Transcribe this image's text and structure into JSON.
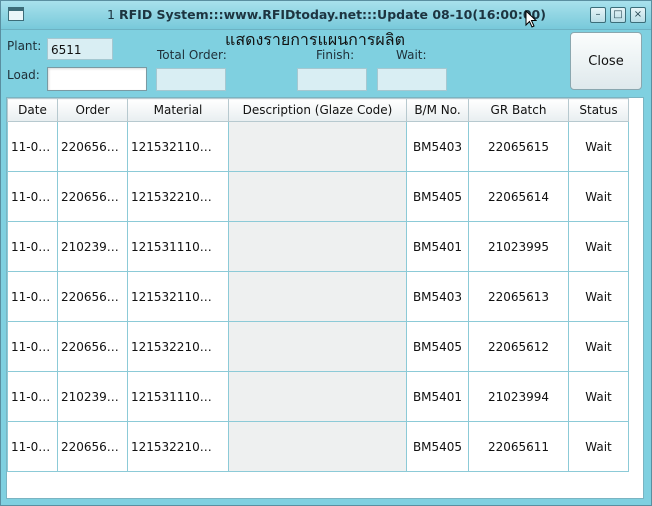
{
  "window": {
    "title_prefix": "1",
    "title": "RFID System:::www.RFIDtoday.net:::Update 08-10(16:00:00)",
    "controls": {
      "minimize": "–",
      "maximize": "□",
      "close": "×"
    }
  },
  "form": {
    "plant_label": "Plant:",
    "plant_value": "6511",
    "load_label": "Load:",
    "load_value": "",
    "heading": "แสดงรายการแผนการผลิต",
    "total_order_label": "Total Order:",
    "total_order_value": "",
    "finish_label": "Finish:",
    "finish_value": "",
    "wait_label": "Wait:",
    "wait_value": "",
    "close_label": "Close"
  },
  "table": {
    "columns": [
      "Date",
      "Order",
      "Material",
      "Description (Glaze Code)",
      "B/M No.",
      "GR Batch",
      "Status"
    ],
    "rows": [
      [
        "11-0…",
        "220656…",
        "121532110…",
        "",
        "BM5403",
        "22065615",
        "Wait"
      ],
      [
        "11-0…",
        "220656…",
        "121532210…",
        "",
        "BM5405",
        "22065614",
        "Wait"
      ],
      [
        "11-0…",
        "210239…",
        "121531110…",
        "",
        "BM5401",
        "21023995",
        "Wait"
      ],
      [
        "11-0…",
        "220656…",
        "121532110…",
        "",
        "BM5403",
        "22065613",
        "Wait"
      ],
      [
        "11-0…",
        "220656…",
        "121532210…",
        "",
        "BM5405",
        "22065612",
        "Wait"
      ],
      [
        "11-0…",
        "210239…",
        "121531110…",
        "",
        "BM5401",
        "21023994",
        "Wait"
      ],
      [
        "11-0…",
        "220656…",
        "121532210…",
        "",
        "BM5405",
        "22065611",
        "Wait"
      ]
    ]
  }
}
